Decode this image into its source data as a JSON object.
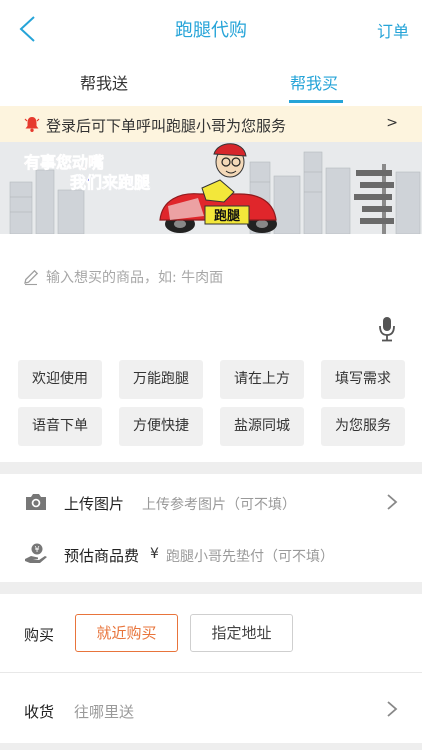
{
  "header": {
    "title": "跑腿代购",
    "orders_label": "订单"
  },
  "tabs": [
    {
      "label": "帮我送",
      "active": false
    },
    {
      "label": "帮我买",
      "active": true
    }
  ],
  "notice": {
    "text": "登录后可下单呼叫跑腿小哥为您服务",
    "arrow": ">"
  },
  "banner": {
    "line1": "有事您动嘴",
    "line2": "我们来跑腿",
    "scooter_text": "跑腿"
  },
  "input": {
    "placeholder": "输入想买的商品，如: 牛肉面"
  },
  "quick_chips": [
    "欢迎使用",
    "万能跑腿",
    "请在上方",
    "填写需求",
    "语音下单",
    "方便快捷",
    "盐源同城",
    "为您服务"
  ],
  "upload": {
    "label": "上传图片",
    "value": "上传参考图片（可不填）"
  },
  "fee": {
    "label": "预估商品费",
    "currency": "¥",
    "value": "跑腿小哥先垫付（可不填）"
  },
  "buy": {
    "label": "购买",
    "options": [
      {
        "label": "就近购买",
        "selected": true
      },
      {
        "label": "指定地址",
        "selected": false
      }
    ]
  },
  "receive": {
    "label": "收货",
    "value": "往哪里送"
  },
  "colors": {
    "accent": "#26a4d8",
    "selected_option": "#e8743b",
    "notice_bg": "#fdf4de"
  }
}
